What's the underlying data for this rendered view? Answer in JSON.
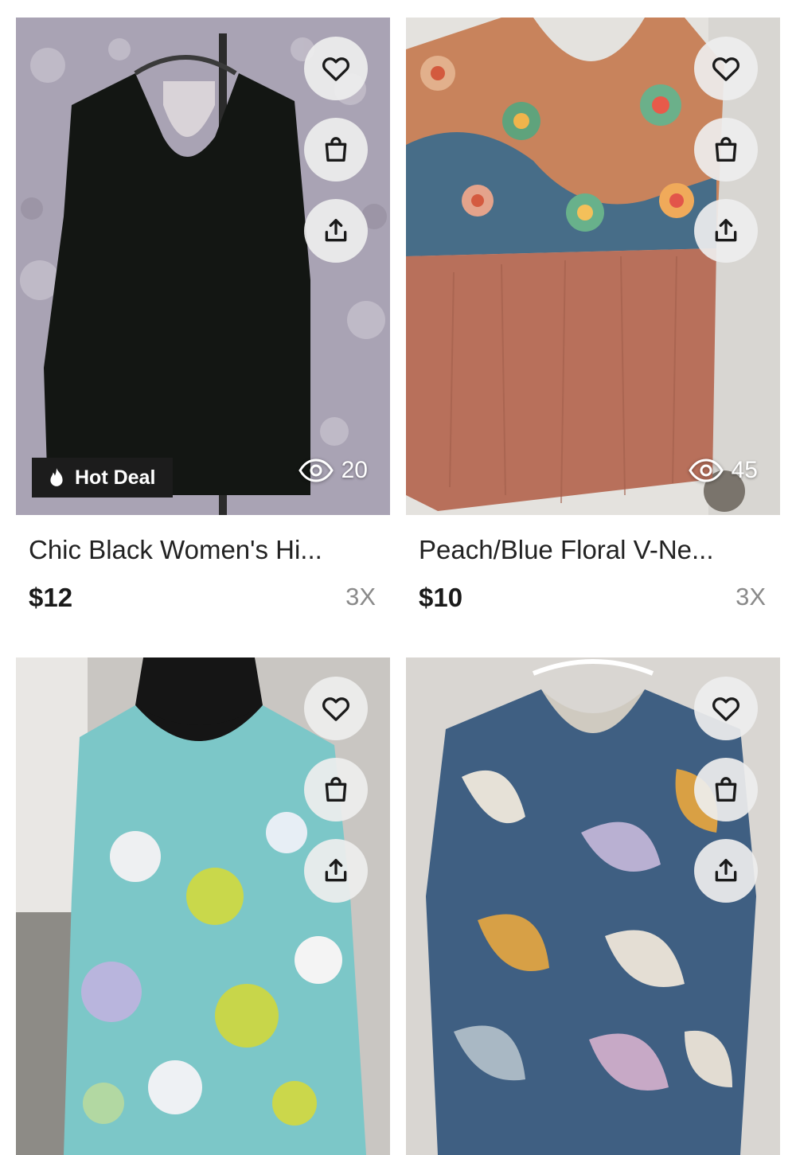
{
  "listings": [
    {
      "title": "Chic Black Women's Hi...",
      "price": "$12",
      "size": "3X",
      "views": "20",
      "badge": "Hot Deal",
      "image": "black-v-neck-top-photo"
    },
    {
      "title": "Peach/Blue Floral V-Ne...",
      "price": "$10",
      "size": "3X",
      "views": "45",
      "badge": "",
      "image": "peach-blue-floral-top-photo"
    },
    {
      "title": "",
      "price": "",
      "size": "",
      "views": "",
      "badge": "",
      "image": "aqua-floral-top-photo"
    },
    {
      "title": "",
      "price": "",
      "size": "",
      "views": "",
      "badge": "",
      "image": "blue-leaf-print-top-photo"
    }
  ],
  "icons": {
    "like": "heart-icon",
    "bag": "shopping-bag-icon",
    "share": "share-icon",
    "views": "eye-icon",
    "hot": "flame-icon"
  },
  "colors": {
    "button_bg": "#eeeeee",
    "badge_bg": "#1c1c1c",
    "price_text": "#1a1a1a",
    "size_text": "#8a8a8a"
  }
}
